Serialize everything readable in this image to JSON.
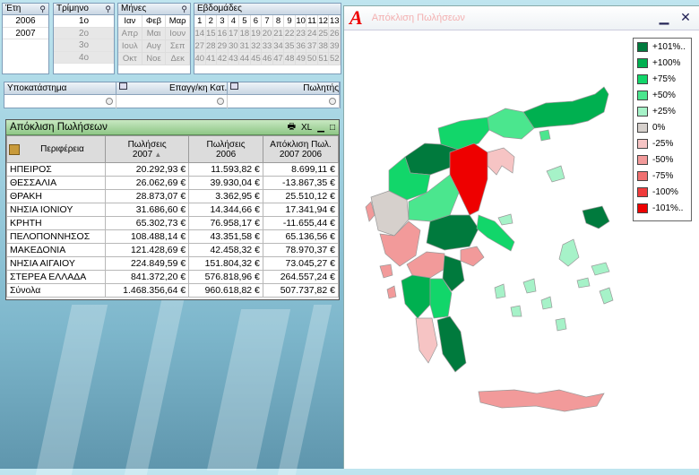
{
  "years": {
    "title": "Έτη",
    "items": [
      {
        "label": "2006",
        "state": "sel"
      },
      {
        "label": "2007",
        "state": "sel"
      }
    ]
  },
  "quarters": {
    "title": "Τρίμηνο",
    "items": [
      {
        "label": "1ο",
        "state": "sel"
      },
      {
        "label": "2ο",
        "state": "gray"
      },
      {
        "label": "3ο",
        "state": "gray"
      },
      {
        "label": "4ο",
        "state": "gray"
      }
    ]
  },
  "months": {
    "title": "Μήνες",
    "items": [
      {
        "label": "Ιαν",
        "state": "w"
      },
      {
        "label": "Φεβ",
        "state": "w"
      },
      {
        "label": "Μαρ",
        "state": "w"
      },
      {
        "label": "Απρ",
        "state": "g"
      },
      {
        "label": "Μαι",
        "state": "g"
      },
      {
        "label": "Ιουν",
        "state": "g"
      },
      {
        "label": "Ιουλ",
        "state": "g"
      },
      {
        "label": "Αυγ",
        "state": "g"
      },
      {
        "label": "Σεπ",
        "state": "g"
      },
      {
        "label": "Οκτ",
        "state": "g"
      },
      {
        "label": "Νοε",
        "state": "g"
      },
      {
        "label": "Δεκ",
        "state": "g"
      }
    ]
  },
  "weeks": {
    "title": "Εβδομάδες",
    "items": [
      "1",
      "2",
      "3",
      "4",
      "5",
      "6",
      "7",
      "8",
      "9",
      "10",
      "11",
      "12",
      "13",
      "14",
      "15",
      "16",
      "17",
      "18",
      "19",
      "20",
      "21",
      "22",
      "23",
      "24",
      "25",
      "26",
      "27",
      "28",
      "29",
      "30",
      "31",
      "32",
      "33",
      "34",
      "35",
      "36",
      "37",
      "38",
      "39",
      "40",
      "41",
      "42",
      "43",
      "44",
      "45",
      "46",
      "47",
      "48",
      "49",
      "50",
      "51",
      "52"
    ],
    "selected_count": 13
  },
  "multibox": {
    "columns": [
      "Υποκατάστημα",
      "Επαγγ/κη Κατ.",
      "Πωλητής"
    ]
  },
  "table": {
    "title": "Απόκλιση Πωλήσεων",
    "xl_label": "XL",
    "headers": [
      "Περιφέρεια",
      "Πωλήσεις\n2007",
      "Πωλήσεις\n2006",
      "Απόκλιση Πωλ.\n2007 2006"
    ],
    "rows": [
      [
        "ΗΠΕΙΡΟΣ",
        "20.292,93 €",
        "11.593,82 €",
        "8.699,11 €"
      ],
      [
        "ΘΕΣΣΑΛΙΑ",
        "26.062,69 €",
        "39.930,04 €",
        "-13.867,35 €"
      ],
      [
        "ΘΡΑΚΗ",
        "28.873,07 €",
        "3.362,95 €",
        "25.510,12 €"
      ],
      [
        "ΝΗΣΙΑ ΙΟΝΙΟΥ",
        "31.686,60 €",
        "14.344,66 €",
        "17.341,94 €"
      ],
      [
        "ΚΡΗΤΗ",
        "65.302,73 €",
        "76.958,17 €",
        "-11.655,44 €"
      ],
      [
        "ΠΕΛΟΠΟΝΝΗΣΟΣ",
        "108.488,14 €",
        "43.351,58 €",
        "65.136,56 €"
      ],
      [
        "ΜΑΚΕΔΟΝΙΑ",
        "121.428,69 €",
        "42.458,32 €",
        "78.970,37 €"
      ],
      [
        "ΝΗΣΙΑ ΑΙΓΑΙΟΥ",
        "224.849,59 €",
        "151.804,32 €",
        "73.045,27 €"
      ],
      [
        "ΣΤΕΡΕΑ ΕΛΛΑΔΑ",
        "841.372,20 €",
        "576.818,96 €",
        "264.557,24 €"
      ]
    ],
    "total": [
      "Σύνολα",
      "1.468.356,64 €",
      "960.618,82 €",
      "507.737,82 €"
    ]
  },
  "map": {
    "logo": "A",
    "title": "Απόκλιση Πωλήσεων",
    "legend": [
      {
        "label": "+101%..",
        "color": "#007a3d"
      },
      {
        "label": "+100%",
        "color": "#00b050"
      },
      {
        "label": "+75%",
        "color": "#12d66a"
      },
      {
        "label": "+50%",
        "color": "#4be68e"
      },
      {
        "label": "+25%",
        "color": "#a6f2c8"
      },
      {
        "label": "0%",
        "color": "#d6d0cc"
      },
      {
        "label": "-25%",
        "color": "#f6c4c4"
      },
      {
        "label": "-50%",
        "color": "#f29a9a"
      },
      {
        "label": "-75%",
        "color": "#f07070"
      },
      {
        "label": "-100%",
        "color": "#f03b3b"
      },
      {
        "label": "-101%..",
        "color": "#ee0000"
      }
    ]
  }
}
